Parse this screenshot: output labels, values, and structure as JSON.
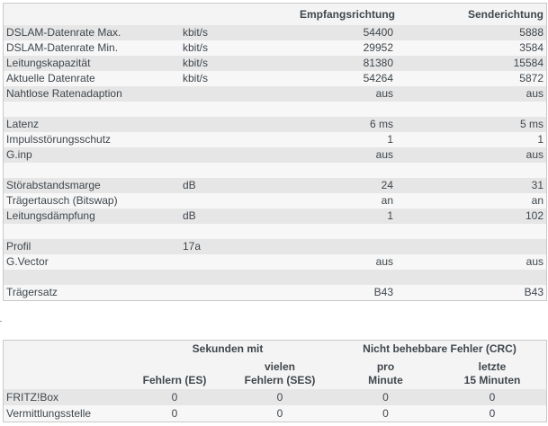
{
  "main_table": {
    "headers": {
      "label": "",
      "unit": "",
      "down": "Empfangsrichtung",
      "up": "Senderichtung"
    },
    "rows": [
      {
        "label": "DSLAM-Datenrate Max.",
        "unit": "kbit/s",
        "down": "54400",
        "up": "5888"
      },
      {
        "label": "DSLAM-Datenrate Min.",
        "unit": "kbit/s",
        "down": "29952",
        "up": "3584"
      },
      {
        "label": "Leitungskapazität",
        "unit": "kbit/s",
        "down": "81380",
        "up": "15584"
      },
      {
        "label": "Aktuelle Datenrate",
        "unit": "kbit/s",
        "down": "54264",
        "up": "5872"
      },
      {
        "label": "Nahtlose Ratenadaption",
        "unit": "",
        "down": "aus",
        "up": "aus"
      },
      {
        "label": "",
        "unit": "",
        "down": "",
        "up": ""
      },
      {
        "label": "Latenz",
        "unit": "",
        "down": "6 ms",
        "up": "5 ms"
      },
      {
        "label": "Impulsstörungsschutz",
        "unit": "",
        "down": "1",
        "up": "1"
      },
      {
        "label": "G.inp",
        "unit": "",
        "down": "aus",
        "up": "aus"
      },
      {
        "label": "",
        "unit": "",
        "down": "",
        "up": ""
      },
      {
        "label": "Störabstandsmarge",
        "unit": "dB",
        "down": "24",
        "up": "31"
      },
      {
        "label": "Trägertausch (Bitswap)",
        "unit": "",
        "down": "an",
        "up": "an"
      },
      {
        "label": "Leitungsdämpfung",
        "unit": "dB",
        "down": "1",
        "up": "102"
      },
      {
        "label": "",
        "unit": "",
        "down": "",
        "up": ""
      },
      {
        "label": "Profil",
        "unit": "17a",
        "down": "",
        "up": ""
      },
      {
        "label": "G.Vector",
        "unit": "",
        "down": "aus",
        "up": "aus"
      },
      {
        "label": "",
        "unit": "",
        "down": "",
        "up": ""
      },
      {
        "label": "Trägersatz",
        "unit": "",
        "down": "B43",
        "up": "B43"
      }
    ]
  },
  "error_table": {
    "group1": "Sekunden mit",
    "group2": "Nicht behebbare Fehler (CRC)",
    "col_es": "Fehlern (ES)",
    "col_ses_1": "vielen",
    "col_ses_2": "Fehlern (SES)",
    "col_pm_1": "pro",
    "col_pm_2": "Minute",
    "col_15_1": "letzte",
    "col_15_2": "15 Minuten",
    "rows": [
      {
        "label": "FRITZ!Box",
        "es": "0",
        "ses": "0",
        "pm": "0",
        "m15": "0"
      },
      {
        "label": "Vermittlungsstelle",
        "es": "0",
        "ses": "0",
        "pm": "0",
        "m15": "0"
      }
    ]
  }
}
